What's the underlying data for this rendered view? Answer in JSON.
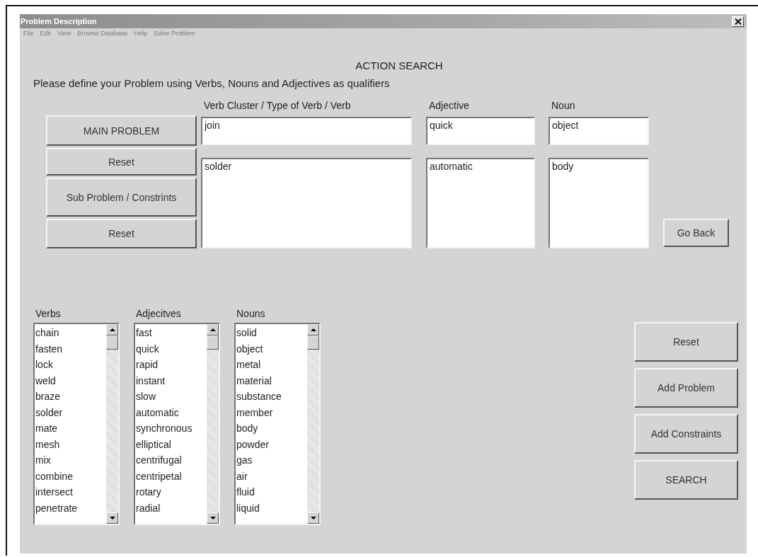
{
  "window": {
    "title": "Problem Description"
  },
  "menu": [
    "File",
    "Edit",
    "View",
    "Browse Database",
    "Help",
    "Solve Problem"
  ],
  "heading": "ACTION SEARCH",
  "instruction": "Please define your Problem using Verbs, Nouns and Adjectives as qualifiers",
  "columns": [
    "Verb Cluster / Type of Verb / Verb",
    "Adjective",
    "Noun"
  ],
  "side_buttons": [
    "MAIN PROBLEM",
    "Reset",
    "Sub Problem / Constrints",
    "Reset"
  ],
  "main_problem": {
    "verb": "join",
    "adjective": "quick",
    "noun": "object"
  },
  "sub_problem": {
    "verb": "solder",
    "adjective": "automatic",
    "noun": "body"
  },
  "go_back": "Go Back",
  "lists": [
    {
      "label": "Verbs",
      "items": [
        "chain",
        "fasten",
        "lock",
        "weld",
        "braze",
        "solder",
        "mate",
        "mesh",
        "mix",
        "combine",
        "intersect",
        "penetrate"
      ]
    },
    {
      "label": "Adjecitves",
      "items": [
        "fast",
        "quick",
        "rapid",
        "instant",
        "slow",
        "automatic",
        "synchronous",
        "elliptical",
        "centrifugal",
        "centripetal",
        "rotary",
        "radial"
      ]
    },
    {
      "label": "Nouns",
      "items": [
        "solid",
        "object",
        "metal",
        "material",
        "substance",
        "member",
        "body",
        "powder",
        "gas",
        "air",
        "fluid",
        "liquid"
      ]
    }
  ],
  "action_buttons": [
    "Reset",
    "Add Problem",
    "Add Constraints",
    "SEARCH"
  ]
}
